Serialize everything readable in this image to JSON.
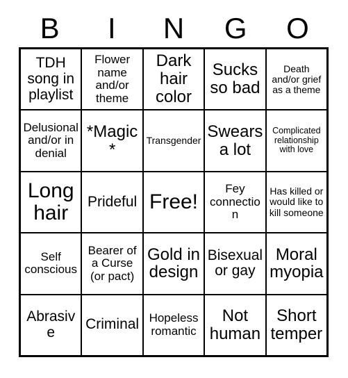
{
  "card": {
    "title": "BINGO",
    "header_letters": [
      "B",
      "I",
      "N",
      "G",
      "O"
    ],
    "free_space_label": "Free!",
    "rows": [
      [
        {
          "text": "TDH song in playlist",
          "size": "lg"
        },
        {
          "text": "Flower name and/or theme",
          "size": "md"
        },
        {
          "text": "Dark hair color",
          "size": "xl"
        },
        {
          "text": "Sucks so bad",
          "size": "xl"
        },
        {
          "text": "Death and/or grief as a theme",
          "size": "sm"
        }
      ],
      [
        {
          "text": "Delusional and/or in denial",
          "size": "md"
        },
        {
          "text": "*Magic*",
          "size": "xl"
        },
        {
          "text": "Transgender",
          "size": "sm"
        },
        {
          "text": "Swears a lot",
          "size": "xl"
        },
        {
          "text": "Complicated relationship with love",
          "size": "xs"
        }
      ],
      [
        {
          "text": "Long hair",
          "size": "xxl"
        },
        {
          "text": "Prideful",
          "size": "lg"
        },
        {
          "text": "Free!",
          "size": "xxl"
        },
        {
          "text": "Fey connection",
          "size": "md"
        },
        {
          "text": "Has killed or would like to kill someone",
          "size": "sm"
        }
      ],
      [
        {
          "text": "Self conscious",
          "size": "md"
        },
        {
          "text": "Bearer of a Curse (or pact)",
          "size": "md"
        },
        {
          "text": "Gold in design",
          "size": "xl"
        },
        {
          "text": "Bisexual or gay",
          "size": "lg"
        },
        {
          "text": "Moral myopia",
          "size": "xl"
        }
      ],
      [
        {
          "text": "Abrasive",
          "size": "lg"
        },
        {
          "text": "Criminal",
          "size": "lg"
        },
        {
          "text": "Hopeless romantic",
          "size": "md"
        },
        {
          "text": "Not human",
          "size": "xl"
        },
        {
          "text": "Short temper",
          "size": "xl"
        }
      ]
    ]
  },
  "colors": {
    "background": "#ffffff",
    "text": "#000000",
    "grid_border": "#000000"
  }
}
